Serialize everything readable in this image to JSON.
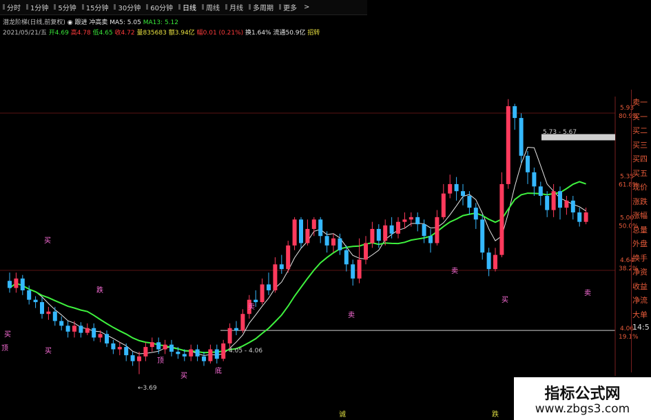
{
  "toolbar": {
    "items": [
      "分时",
      "1分钟",
      "5分钟",
      "15分钟",
      "30分钟",
      "60分钟",
      "日线",
      "周线",
      "月线",
      "多周期",
      "更多"
    ],
    "active_index": 6,
    "chevron": ">"
  },
  "info": {
    "indicator_name": "潜龙阶梯(日线,前复权)",
    "mode": "◉ 跟进 冲高卖",
    "ma5": "MA5: 5.05",
    "ma13": "MA13: 5.12",
    "date": "2021/05/21/五",
    "open": "开4.69",
    "high": "高4.78",
    "low": "低4.65",
    "close": "收4.72",
    "volume": "量835683",
    "amount": "额3.94亿",
    "change": "幅0.01 (0.21%)",
    "turnover": "换1.64%",
    "float": "流通50.9亿",
    "extra": "招转"
  },
  "price_axis": [
    {
      "price": "5.93",
      "pct": "80.9%"
    },
    {
      "price": "5.35",
      "pct": "61.8%"
    },
    {
      "price": "5.00",
      "pct": "50.0%"
    },
    {
      "price": "4.64",
      "pct": "38.2%"
    },
    {
      "price": "4.06",
      "pct": "19.1%"
    }
  ],
  "right_panel": [
    "卖一",
    "买一",
    "买二",
    "买三",
    "买四",
    "买五",
    "现价",
    "涨跌",
    "涨幅",
    "总量",
    "外盘",
    "换手",
    "净资",
    "收益",
    "净流",
    "大单",
    "14:5"
  ],
  "annotations": {
    "range_high": "5.73 - 5.67",
    "range_low": "4.05 - 4.06",
    "min_price": "←3.69",
    "bottom_a": "诚",
    "bottom_b": "跌"
  },
  "markers": [
    "顶",
    "买",
    "买",
    "底",
    "卖",
    "买",
    "跌",
    "卖",
    "卖",
    "买",
    "买",
    "顶",
    "卖"
  ],
  "colors": {
    "up": "#ff3a5c",
    "down": "#35b8ff",
    "ma_white": "#e8e8e8",
    "ma_green": "#3ef23e",
    "level_line": "#9a4040"
  },
  "watermark": {
    "title": "指标公式网",
    "url": "www.zbgs3.com"
  },
  "chart_data": {
    "type": "candlestick",
    "y_axis": {
      "min": 3.5,
      "max": 6.1
    },
    "candles": [
      [
        4.48,
        4.42,
        4.55,
        4.38
      ],
      [
        4.42,
        4.5,
        4.55,
        4.38
      ],
      [
        4.5,
        4.4,
        4.53,
        4.36
      ],
      [
        4.4,
        4.32,
        4.44,
        4.28
      ],
      [
        4.32,
        4.3,
        4.35,
        4.25
      ],
      [
        4.3,
        4.2,
        4.34,
        4.16
      ],
      [
        4.2,
        4.22,
        4.26,
        4.15
      ],
      [
        4.22,
        4.14,
        4.26,
        4.1
      ],
      [
        4.14,
        4.1,
        4.18,
        4.06
      ],
      [
        4.1,
        4.05,
        4.14,
        4.0
      ],
      [
        4.05,
        4.1,
        4.14,
        4.0
      ],
      [
        4.1,
        4.04,
        4.13,
        4.0
      ],
      [
        4.04,
        4.08,
        4.12,
        4.02
      ],
      [
        4.08,
        4.0,
        4.12,
        3.97
      ],
      [
        4.0,
        4.03,
        4.06,
        3.96
      ],
      [
        4.03,
        3.95,
        4.06,
        3.92
      ],
      [
        3.95,
        3.9,
        3.98,
        3.86
      ],
      [
        3.9,
        3.92,
        3.96,
        3.85
      ],
      [
        3.92,
        3.85,
        3.95,
        3.8
      ],
      [
        3.85,
        3.8,
        3.88,
        3.76
      ],
      [
        3.8,
        3.84,
        3.88,
        3.69
      ],
      [
        3.84,
        3.92,
        3.96,
        3.8
      ],
      [
        3.92,
        3.96,
        4.0,
        3.88
      ],
      [
        3.96,
        3.9,
        4.0,
        3.86
      ],
      [
        3.9,
        3.94,
        3.98,
        3.86
      ],
      [
        3.94,
        3.88,
        3.98,
        3.84
      ],
      [
        3.88,
        3.86,
        3.92,
        3.82
      ],
      [
        3.86,
        3.84,
        3.9,
        3.8
      ],
      [
        3.84,
        3.9,
        3.94,
        3.8
      ],
      [
        3.9,
        3.84,
        3.94,
        3.8
      ],
      [
        3.84,
        3.8,
        3.88,
        3.76
      ],
      [
        3.8,
        3.9,
        3.94,
        3.78
      ],
      [
        3.9,
        3.82,
        3.94,
        3.78
      ],
      [
        3.82,
        3.95,
        3.98,
        3.8
      ],
      [
        3.95,
        4.08,
        4.12,
        3.9
      ],
      [
        4.08,
        4.06,
        4.14,
        4.02
      ],
      [
        4.06,
        4.2,
        4.24,
        4.04
      ],
      [
        4.2,
        4.32,
        4.36,
        4.16
      ],
      [
        4.32,
        4.3,
        4.4,
        4.26
      ],
      [
        4.3,
        4.45,
        4.5,
        4.28
      ],
      [
        4.45,
        4.4,
        4.55,
        4.36
      ],
      [
        4.4,
        4.62,
        4.68,
        4.38
      ],
      [
        4.62,
        4.58,
        4.7,
        4.54
      ],
      [
        4.58,
        4.78,
        4.82,
        4.55
      ],
      [
        4.78,
        5.0,
        5.02,
        4.74
      ],
      [
        5.0,
        4.8,
        5.02,
        4.76
      ],
      [
        4.8,
        4.92,
        5.0,
        4.78
      ],
      [
        4.92,
        5.0,
        5.02,
        4.86
      ],
      [
        5.0,
        4.86,
        5.02,
        4.8
      ],
      [
        4.86,
        4.78,
        4.9,
        4.72
      ],
      [
        4.78,
        4.84,
        4.88,
        4.72
      ],
      [
        4.84,
        4.74,
        4.88,
        4.7
      ],
      [
        4.74,
        4.62,
        4.78,
        4.56
      ],
      [
        4.62,
        4.5,
        4.66,
        4.44
      ],
      [
        4.5,
        4.66,
        4.84,
        4.46
      ],
      [
        4.66,
        4.8,
        4.86,
        4.62
      ],
      [
        4.8,
        4.92,
        4.98,
        4.76
      ],
      [
        4.92,
        4.82,
        4.96,
        4.76
      ],
      [
        4.82,
        4.95,
        5.0,
        4.78
      ],
      [
        4.95,
        4.88,
        5.02,
        4.84
      ],
      [
        4.88,
        4.98,
        5.02,
        4.84
      ],
      [
        4.98,
        5.0,
        5.06,
        4.92
      ],
      [
        5.0,
        5.02,
        5.06,
        4.94
      ],
      [
        5.02,
        4.96,
        5.06,
        4.9
      ],
      [
        4.96,
        4.86,
        5.0,
        4.8
      ],
      [
        4.86,
        4.8,
        4.92,
        4.72
      ],
      [
        4.8,
        5.02,
        5.08,
        4.78
      ],
      [
        5.02,
        5.22,
        5.3,
        5.0
      ],
      [
        5.22,
        5.3,
        5.38,
        5.18
      ],
      [
        5.3,
        5.24,
        5.36,
        5.16
      ],
      [
        5.24,
        5.2,
        5.3,
        5.12
      ],
      [
        5.2,
        5.1,
        5.24,
        5.04
      ],
      [
        5.1,
        5.0,
        5.14,
        4.92
      ],
      [
        5.0,
        4.72,
        5.04,
        4.66
      ],
      [
        4.72,
        4.58,
        4.76,
        4.52
      ],
      [
        4.58,
        4.7,
        4.76,
        4.56
      ],
      [
        4.7,
        5.3,
        5.4,
        4.68
      ],
      [
        5.3,
        5.96,
        6.02,
        5.26
      ],
      [
        5.96,
        5.86,
        5.98,
        5.76
      ],
      [
        5.86,
        5.54,
        5.9,
        5.48
      ],
      [
        5.54,
        5.4,
        5.58,
        5.3
      ],
      [
        5.4,
        5.28,
        5.44,
        5.2
      ],
      [
        5.28,
        5.2,
        5.32,
        5.12
      ],
      [
        5.2,
        5.08,
        5.24,
        5.02
      ],
      [
        5.08,
        5.24,
        5.3,
        5.02
      ],
      [
        5.24,
        5.1,
        5.28,
        5.0
      ],
      [
        5.1,
        5.16,
        5.2,
        5.04
      ],
      [
        5.16,
        5.06,
        5.2,
        5.0
      ],
      [
        5.06,
        4.98,
        5.1,
        4.94
      ],
      [
        4.98,
        5.06,
        5.1,
        4.96
      ]
    ],
    "level_lines": [
      5.93,
      4.06
    ],
    "range_box_price": 5.7
  }
}
